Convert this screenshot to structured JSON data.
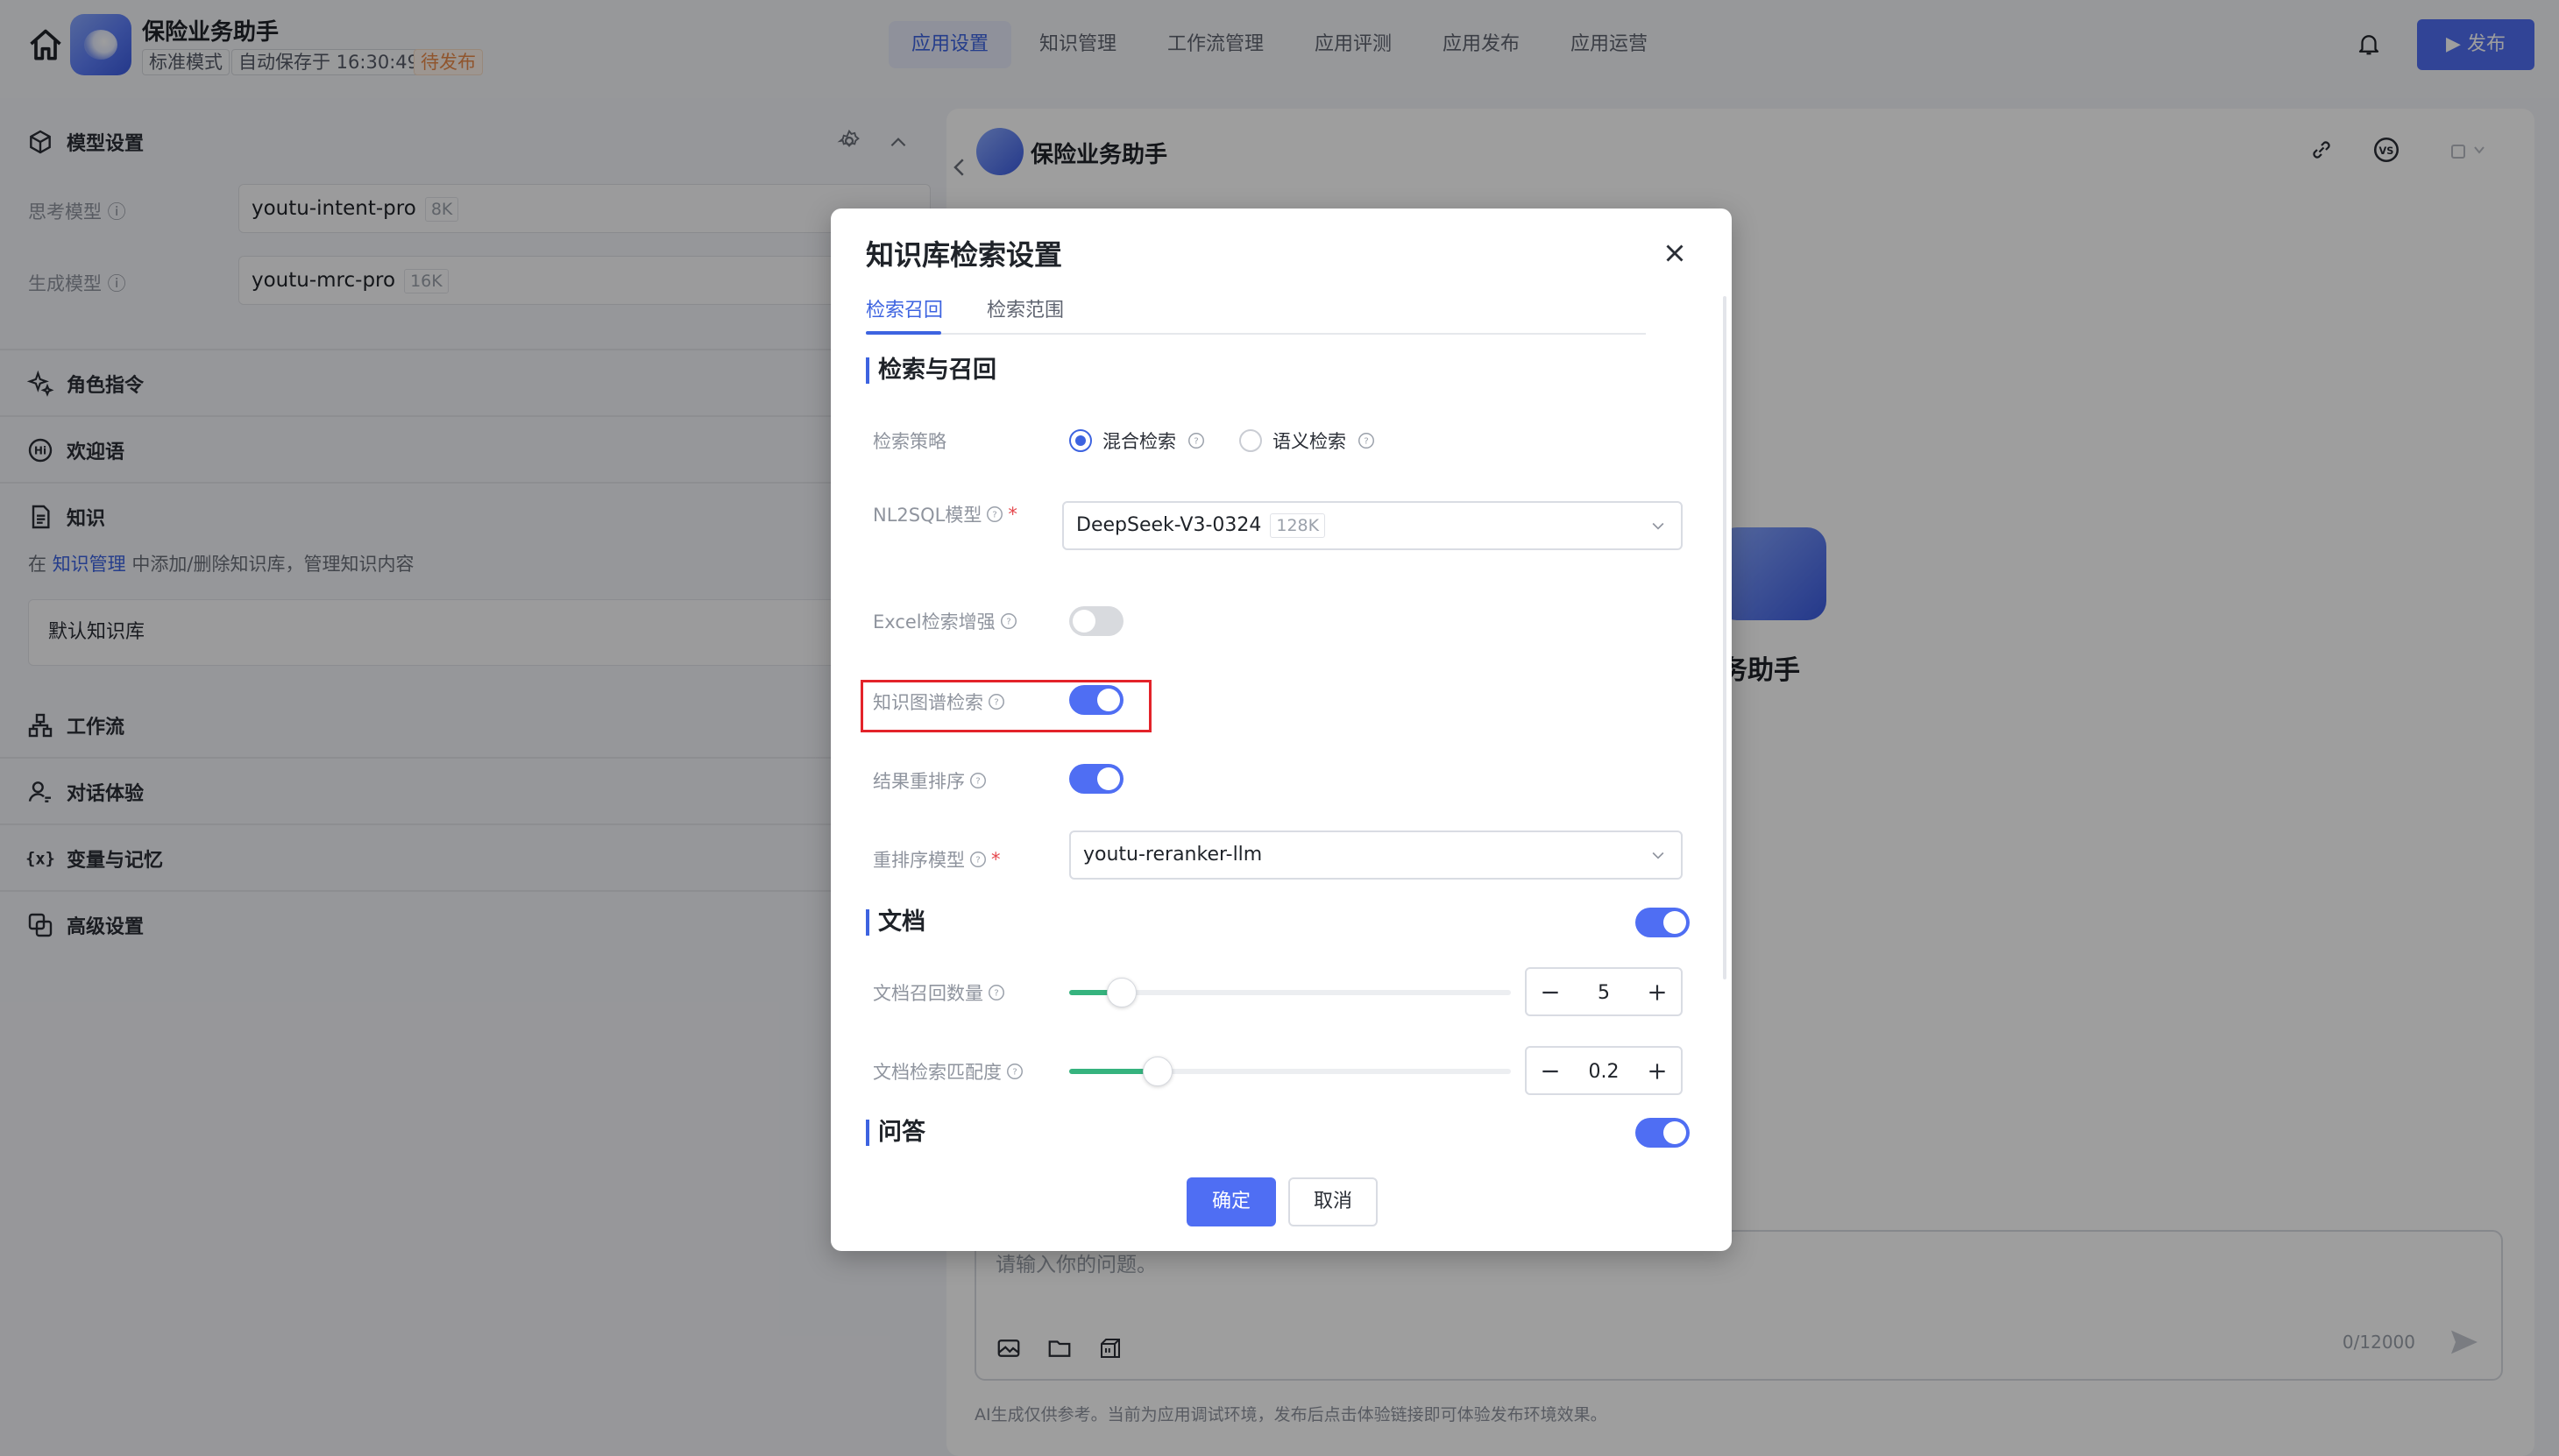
{
  "app": {
    "name": "保险业务助手",
    "mode": "标准模式",
    "autosave": "自动保存于 16:30:49",
    "status": "待发布"
  },
  "nav": [
    "应用设置",
    "知识管理",
    "工作流管理",
    "应用评测",
    "应用发布",
    "应用运营"
  ],
  "publish_label": "发布",
  "left": {
    "model_settings": "模型设置",
    "think_model_label": "思考模型",
    "think_model": "youtu-intent-pro",
    "think_model_ctx": "8K",
    "gen_model_label": "生成模型",
    "gen_model": "youtu-mrc-pro",
    "gen_model_ctx": "16K",
    "role": "角色指令",
    "welcome": "欢迎语",
    "knowledge": "知识",
    "hint_pre": "在",
    "hint_link": "知识管理",
    "hint_post": "中添加/删除知识库，管理知识内容",
    "default_kb": "默认知识库",
    "workflow": "工作流",
    "dialog": "对话体验",
    "vars": "变量与记忆",
    "advanced": "高级设置"
  },
  "right": {
    "title": "保险业务助手",
    "bg_name": "务助手",
    "input_placeholder": "请输入你的问题。",
    "counter": "0/12000",
    "disclaimer": "AI生成仅供参考。当前为应用调试环境，发布后点击体验链接即可体验发布环境效果。"
  },
  "modal": {
    "title": "知识库检索设置",
    "tabs": [
      "检索召回",
      "检索范围"
    ],
    "group_retrieval": "检索与召回",
    "strategy_label": "检索策略",
    "radio_hybrid": "混合检索",
    "radio_semantic": "语义检索",
    "nl2sql_label": "NL2SQL模型",
    "nl2sql_model": "DeepSeek-V3-0324",
    "nl2sql_ctx": "128K",
    "excel_label": "Excel检索增强",
    "kg_label": "知识图谱检索",
    "rerank_label": "结果重排序",
    "rerank_model_label": "重排序模型",
    "rerank_model": "youtu-reranker-llm",
    "group_doc": "文档",
    "doc_count_label": "文档召回数量",
    "doc_count": "5",
    "doc_match_label": "文档检索匹配度",
    "doc_match": "0.2",
    "group_qa": "问答",
    "ok": "确定",
    "cancel": "取消",
    "toggles": {
      "excel": false,
      "kg": true,
      "rerank": true,
      "doc": true,
      "qa": true
    },
    "sliders": {
      "doc_count": 0.12,
      "doc_match": 0.2
    }
  },
  "colors": {
    "accent": "#4f6ef3",
    "warn": "#e8894a",
    "slider": "#36b37e",
    "highlight": "#e3232a"
  }
}
